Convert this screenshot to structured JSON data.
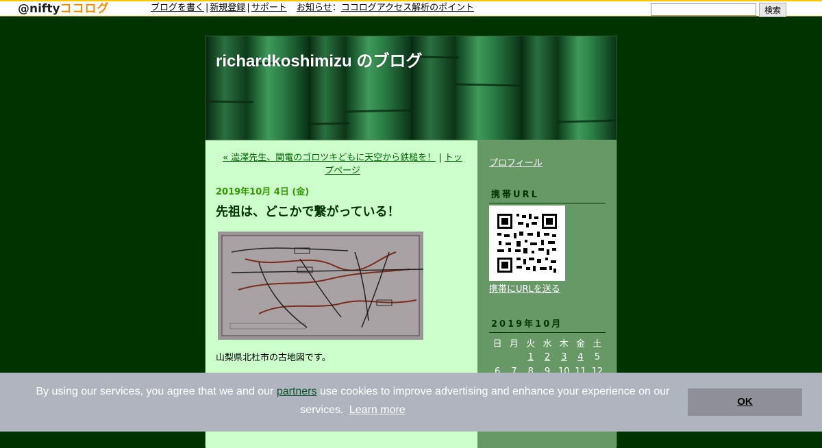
{
  "topbar": {
    "logo_prefix": "@nifty",
    "logo_brand": "ココログ",
    "nav": [
      "ブログを書く",
      "新規登録",
      "サポート"
    ],
    "notice_label": "お知らせ",
    "notice_colon": "：",
    "notice_link": "ココログアクセス解析のポイント",
    "search_placeholder": "",
    "search_button": "検索"
  },
  "blog": {
    "title": "richardkoshimizu のブログ"
  },
  "post": {
    "nav_prev": "« 澁澤先生、関電のゴロツキどもに天空から鉄槌を！",
    "nav_sep": " | ",
    "nav_top": "トップページ",
    "date": "2019年10月 4日 (金)",
    "title": "先祖は、どこかで繋がっている！",
    "text": "山梨県北杜市の古地図です。"
  },
  "sidebar": {
    "profile_link": "プロフィール",
    "mobile_heading": "携帯URL",
    "mobile_send_link": "携帯にURLを送る",
    "calendar_heading": "2019年10月",
    "weekdays": [
      "日",
      "月",
      "火",
      "水",
      "木",
      "金",
      "土"
    ],
    "weeks": [
      [
        "",
        "",
        "1",
        "2",
        "3",
        "4",
        "5"
      ],
      [
        "6",
        "7",
        "8",
        "9",
        "10",
        "11",
        "12"
      ]
    ]
  },
  "cookie": {
    "text_before": "By using our services, you agree that we and our ",
    "partners_link": "partners",
    "text_after": " use cookies to improve advertising and enhance your experience on our services.",
    "learn_more": "Learn more",
    "ok_button": "OK"
  },
  "colors": {
    "page_bg": "#003300",
    "content_bg": "#ccffcc",
    "sidebar_bg": "#669966",
    "date_color": "#339900",
    "cookie_bg": "#b0b4be"
  }
}
